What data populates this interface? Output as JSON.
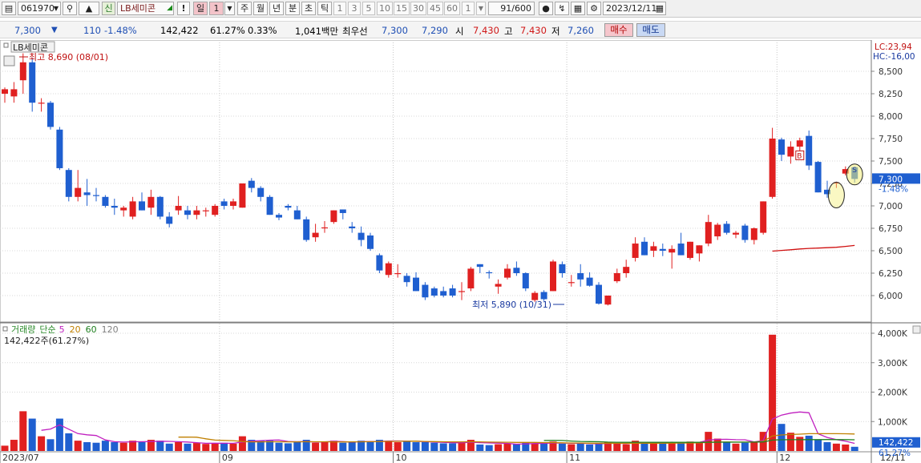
{
  "toolbar": {
    "code": "061970",
    "type_badge": "신",
    "stock_name": "LB세미콘",
    "period_buttons": [
      "!",
      "일",
      "1",
      "주",
      "월",
      "년",
      "분",
      "초",
      "틱"
    ],
    "interval_buttons": [
      "1",
      "3",
      "5",
      "10",
      "15",
      "30",
      "45",
      "60"
    ],
    "interval_value": "1",
    "count": "91",
    "count_max": "/600",
    "date": "2023/12/11"
  },
  "info": {
    "price": "7,300",
    "direction": "▼",
    "change": "110",
    "change_pct": "-1.48%",
    "volume": "142,422",
    "volume_ratio": "61.27%",
    "turnover_pct": "0.33%",
    "amount": "1,041백만",
    "ask_label": "최우선",
    "ask": "7,300",
    "bid": "7,290",
    "open_label": "시",
    "open": "7,430",
    "high_label": "고",
    "high": "7,430",
    "low_label": "저",
    "low": "7,260",
    "buy_button": "매수",
    "sell_button": "매도"
  },
  "colors": {
    "up": "#e02020",
    "down": "#1f5fd0",
    "accent": "#c02020"
  },
  "chart_data": {
    "type": "candlestick",
    "price_panel": {
      "title": "LB세미콘",
      "ylim": [
        5750,
        8750
      ],
      "yticks": [
        "8,500",
        "8,250",
        "8,000",
        "7,750",
        "7,500",
        "7,250",
        "7,000",
        "6,750",
        "6,500",
        "6,250",
        "6,000"
      ],
      "lc_label": "LC:23,94",
      "hc_label": "HC:-16,00",
      "current_tag": "7,300",
      "current_pct": "-1.48%",
      "high_annotation": "최고 8,690 (08/01)",
      "low_annotation": "최저 5,890 (10/31)",
      "signal_buy": "B",
      "signal_sell": "S"
    },
    "volume_panel": {
      "legend": [
        "거래량",
        "단순",
        "5",
        "20",
        "60",
        "120"
      ],
      "legend_colors": [
        "#2a8a2a",
        "#2a8a2a",
        "#c020c0",
        "#c08000",
        "#208020",
        "#808080"
      ],
      "value_label": "142,422주(61.27%)",
      "ylim": [
        0,
        4000000
      ],
      "yticks": [
        "4,000K",
        "3,000K",
        "2,000K",
        "1,000K"
      ],
      "current_tag": "142,422",
      "current_pct": "61.27%"
    },
    "x_labels": [
      "2023/07",
      "09",
      "10",
      "11",
      "12",
      "12/11"
    ],
    "candles": [
      {
        "o": 8250,
        "h": 8320,
        "l": 8150,
        "c": 8300,
        "v": 180000
      },
      {
        "o": 8220,
        "h": 8380,
        "l": 8150,
        "c": 8300,
        "v": 380000
      },
      {
        "o": 8400,
        "h": 8700,
        "l": 8250,
        "c": 8600,
        "v": 1350000
      },
      {
        "o": 8600,
        "h": 8650,
        "l": 8050,
        "c": 8150,
        "v": 1100000
      },
      {
        "o": 8150,
        "h": 8200,
        "l": 8050,
        "c": 8150,
        "v": 500000
      },
      {
        "o": 8150,
        "h": 8170,
        "l": 7850,
        "c": 7880,
        "v": 400000
      },
      {
        "o": 7850,
        "h": 7880,
        "l": 7400,
        "c": 7420,
        "v": 1100000
      },
      {
        "o": 7400,
        "h": 7420,
        "l": 7050,
        "c": 7100,
        "v": 600000
      },
      {
        "o": 7100,
        "h": 7400,
        "l": 7050,
        "c": 7200,
        "v": 350000
      },
      {
        "o": 7150,
        "h": 7300,
        "l": 7000,
        "c": 7120,
        "v": 300000
      },
      {
        "o": 7120,
        "h": 7200,
        "l": 7050,
        "c": 7110,
        "v": 280000
      },
      {
        "o": 7100,
        "h": 7120,
        "l": 6980,
        "c": 7000,
        "v": 350000
      },
      {
        "o": 7000,
        "h": 7080,
        "l": 6900,
        "c": 6980,
        "v": 300000
      },
      {
        "o": 6950,
        "h": 7000,
        "l": 6880,
        "c": 6980,
        "v": 280000
      },
      {
        "o": 6880,
        "h": 7100,
        "l": 6850,
        "c": 7050,
        "v": 350000
      },
      {
        "o": 7050,
        "h": 7150,
        "l": 6950,
        "c": 6950,
        "v": 300000
      },
      {
        "o": 6980,
        "h": 7180,
        "l": 6900,
        "c": 7100,
        "v": 380000
      },
      {
        "o": 7100,
        "h": 7110,
        "l": 6850,
        "c": 6880,
        "v": 350000
      },
      {
        "o": 6880,
        "h": 6930,
        "l": 6760,
        "c": 6800,
        "v": 250000
      },
      {
        "o": 6950,
        "h": 7110,
        "l": 6900,
        "c": 7000,
        "v": 300000
      },
      {
        "o": 6950,
        "h": 7000,
        "l": 6850,
        "c": 6900,
        "v": 250000
      },
      {
        "o": 6900,
        "h": 7000,
        "l": 6850,
        "c": 6950,
        "v": 270000
      },
      {
        "o": 6950,
        "h": 6980,
        "l": 6880,
        "c": 6950,
        "v": 240000
      },
      {
        "o": 6900,
        "h": 7020,
        "l": 6880,
        "c": 7000,
        "v": 260000
      },
      {
        "o": 7050,
        "h": 7080,
        "l": 6960,
        "c": 7000,
        "v": 280000
      },
      {
        "o": 7000,
        "h": 7080,
        "l": 6960,
        "c": 7050,
        "v": 250000
      },
      {
        "o": 6980,
        "h": 7250,
        "l": 6980,
        "c": 7250,
        "v": 500000
      },
      {
        "o": 7280,
        "h": 7310,
        "l": 7150,
        "c": 7200,
        "v": 380000
      },
      {
        "o": 7200,
        "h": 7220,
        "l": 7050,
        "c": 7100,
        "v": 350000
      },
      {
        "o": 7100,
        "h": 7120,
        "l": 6900,
        "c": 6900,
        "v": 350000
      },
      {
        "o": 6900,
        "h": 6920,
        "l": 6840,
        "c": 6870,
        "v": 280000
      },
      {
        "o": 7000,
        "h": 7020,
        "l": 6950,
        "c": 6980,
        "v": 260000
      },
      {
        "o": 6950,
        "h": 7000,
        "l": 6850,
        "c": 6850,
        "v": 330000
      },
      {
        "o": 6850,
        "h": 6880,
        "l": 6600,
        "c": 6620,
        "v": 380000
      },
      {
        "o": 6650,
        "h": 6800,
        "l": 6600,
        "c": 6700,
        "v": 280000
      },
      {
        "o": 6750,
        "h": 6830,
        "l": 6700,
        "c": 6760,
        "v": 300000
      },
      {
        "o": 6820,
        "h": 6950,
        "l": 6800,
        "c": 6950,
        "v": 350000
      },
      {
        "o": 6960,
        "h": 6960,
        "l": 6850,
        "c": 6920,
        "v": 280000
      },
      {
        "o": 6770,
        "h": 6820,
        "l": 6700,
        "c": 6750,
        "v": 300000
      },
      {
        "o": 6700,
        "h": 6770,
        "l": 6550,
        "c": 6620,
        "v": 350000
      },
      {
        "o": 6670,
        "h": 6700,
        "l": 6500,
        "c": 6520,
        "v": 320000
      },
      {
        "o": 6450,
        "h": 6470,
        "l": 6250,
        "c": 6280,
        "v": 380000
      },
      {
        "o": 6230,
        "h": 6380,
        "l": 6200,
        "c": 6360,
        "v": 350000
      },
      {
        "o": 6250,
        "h": 6350,
        "l": 6200,
        "c": 6250,
        "v": 300000
      },
      {
        "o": 6220,
        "h": 6250,
        "l": 6100,
        "c": 6150,
        "v": 330000
      },
      {
        "o": 6200,
        "h": 6260,
        "l": 6050,
        "c": 6050,
        "v": 300000
      },
      {
        "o": 6120,
        "h": 6150,
        "l": 5950,
        "c": 5980,
        "v": 300000
      },
      {
        "o": 6080,
        "h": 6100,
        "l": 5980,
        "c": 6000,
        "v": 280000
      },
      {
        "o": 6050,
        "h": 6100,
        "l": 5980,
        "c": 6000,
        "v": 260000
      },
      {
        "o": 6080,
        "h": 6120,
        "l": 5980,
        "c": 6000,
        "v": 260000
      },
      {
        "o": 6050,
        "h": 6150,
        "l": 5950,
        "c": 6050,
        "v": 300000
      },
      {
        "o": 6080,
        "h": 6320,
        "l": 6050,
        "c": 6300,
        "v": 380000
      },
      {
        "o": 6350,
        "h": 6350,
        "l": 6250,
        "c": 6320,
        "v": 220000
      },
      {
        "o": 6260,
        "h": 6280,
        "l": 6190,
        "c": 6250,
        "v": 200000
      },
      {
        "o": 6100,
        "h": 6180,
        "l": 6020,
        "c": 6130,
        "v": 230000
      },
      {
        "o": 6200,
        "h": 6350,
        "l": 6180,
        "c": 6300,
        "v": 260000
      },
      {
        "o": 6310,
        "h": 6380,
        "l": 6220,
        "c": 6250,
        "v": 240000
      },
      {
        "o": 6250,
        "h": 6260,
        "l": 6050,
        "c": 6080,
        "v": 280000
      },
      {
        "o": 5950,
        "h": 6050,
        "l": 5930,
        "c": 6030,
        "v": 260000
      },
      {
        "o": 6040,
        "h": 6060,
        "l": 5940,
        "c": 5960,
        "v": 250000
      },
      {
        "o": 6050,
        "h": 6400,
        "l": 6050,
        "c": 6380,
        "v": 320000
      },
      {
        "o": 6350,
        "h": 6380,
        "l": 6200,
        "c": 6250,
        "v": 250000
      },
      {
        "o": 6150,
        "h": 6230,
        "l": 6100,
        "c": 6150,
        "v": 230000
      },
      {
        "o": 6250,
        "h": 6350,
        "l": 6100,
        "c": 6180,
        "v": 250000
      },
      {
        "o": 6200,
        "h": 6260,
        "l": 6100,
        "c": 6110,
        "v": 220000
      },
      {
        "o": 6120,
        "h": 6150,
        "l": 5900,
        "c": 5910,
        "v": 280000
      },
      {
        "o": 5900,
        "h": 6000,
        "l": 5890,
        "c": 6000,
        "v": 300000
      },
      {
        "o": 6160,
        "h": 6300,
        "l": 6140,
        "c": 6250,
        "v": 250000
      },
      {
        "o": 6250,
        "h": 6400,
        "l": 6200,
        "c": 6320,
        "v": 230000
      },
      {
        "o": 6420,
        "h": 6650,
        "l": 6380,
        "c": 6580,
        "v": 350000
      },
      {
        "o": 6600,
        "h": 6650,
        "l": 6450,
        "c": 6450,
        "v": 300000
      },
      {
        "o": 6500,
        "h": 6600,
        "l": 6430,
        "c": 6550,
        "v": 280000
      },
      {
        "o": 6520,
        "h": 6580,
        "l": 6440,
        "c": 6500,
        "v": 260000
      },
      {
        "o": 6480,
        "h": 6560,
        "l": 6300,
        "c": 6520,
        "v": 300000
      },
      {
        "o": 6580,
        "h": 6700,
        "l": 6450,
        "c": 6450,
        "v": 280000
      },
      {
        "o": 6420,
        "h": 6600,
        "l": 6400,
        "c": 6600,
        "v": 320000
      },
      {
        "o": 6470,
        "h": 6560,
        "l": 6380,
        "c": 6560,
        "v": 300000
      },
      {
        "o": 6580,
        "h": 6900,
        "l": 6550,
        "c": 6820,
        "v": 650000
      },
      {
        "o": 6660,
        "h": 6810,
        "l": 6620,
        "c": 6790,
        "v": 420000
      },
      {
        "o": 6800,
        "h": 6830,
        "l": 6680,
        "c": 6700,
        "v": 300000
      },
      {
        "o": 6680,
        "h": 6720,
        "l": 6640,
        "c": 6700,
        "v": 250000
      },
      {
        "o": 6780,
        "h": 6800,
        "l": 6590,
        "c": 6620,
        "v": 280000
      },
      {
        "o": 6620,
        "h": 6760,
        "l": 6570,
        "c": 6750,
        "v": 300000
      },
      {
        "o": 6700,
        "h": 7050,
        "l": 6680,
        "c": 7050,
        "v": 650000
      },
      {
        "o": 7100,
        "h": 7870,
        "l": 7080,
        "c": 7750,
        "v": 3950000
      },
      {
        "o": 7740,
        "h": 7760,
        "l": 7500,
        "c": 7570,
        "v": 920000
      },
      {
        "o": 7550,
        "h": 7720,
        "l": 7470,
        "c": 7660,
        "v": 620000
      },
      {
        "o": 7660,
        "h": 7760,
        "l": 7560,
        "c": 7730,
        "v": 480000
      },
      {
        "o": 7780,
        "h": 7840,
        "l": 7400,
        "c": 7450,
        "v": 520000
      },
      {
        "o": 7490,
        "h": 7500,
        "l": 7150,
        "c": 7150,
        "v": 380000
      },
      {
        "o": 7180,
        "h": 7280,
        "l": 7090,
        "c": 7130,
        "v": 300000
      },
      {
        "o": 7260,
        "h": 7270,
        "l": 7200,
        "c": 7260,
        "v": 250000
      },
      {
        "o": 7360,
        "h": 7440,
        "l": 7340,
        "c": 7410,
        "v": 220000
      },
      {
        "o": 7430,
        "h": 7430,
        "l": 7260,
        "c": 7300,
        "v": 142422
      }
    ]
  }
}
